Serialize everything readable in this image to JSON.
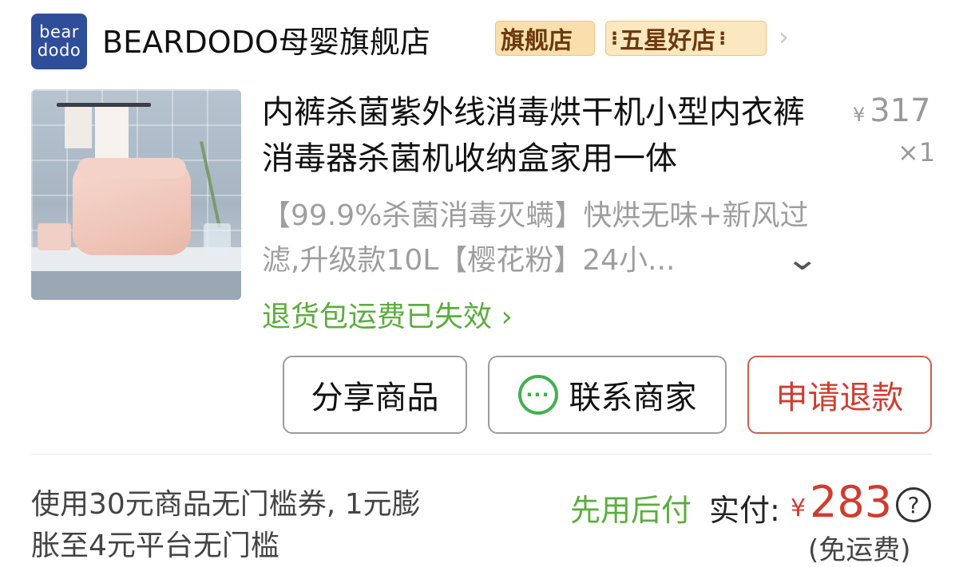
{
  "store": {
    "logo_line1": "bear",
    "logo_line2": "dodo",
    "name": "BEARDODO母婴旗舰店",
    "badge_flagship": "旗舰店",
    "badge_rating": "五星好店",
    "chevron": "›"
  },
  "product": {
    "title": "内裤杀菌紫外线消毒烘干机小型内衣裤消毒器杀菌机收纳盒家用一体",
    "price_symbol": "¥",
    "price": "317",
    "quantity": "×1",
    "sku": "【99.9%杀菌消毒灭螨】快烘无味+新风过滤,升级款10L【樱花粉】24小...",
    "sku_expand_icon": "chevron-down-icon",
    "return_note": "退货包运费已失效 ›"
  },
  "actions": {
    "share": "分享商品",
    "contact": "联系商家",
    "contact_icon": "···",
    "refund": "申请退款"
  },
  "summary": {
    "coupon_note": "使用30元商品无门槛券, 1元膨胀至4元平台无门槛",
    "pay_later": "先用后付",
    "paid_label": "实付:",
    "paid_symbol": "¥",
    "paid_amount": "283",
    "help": "?",
    "freight": "(免运费)"
  },
  "colors": {
    "accent_red": "#d03c30",
    "accent_green": "#5aad3c",
    "logo_blue": "#2f4e9a",
    "badge_gold": "#f8dfab"
  }
}
